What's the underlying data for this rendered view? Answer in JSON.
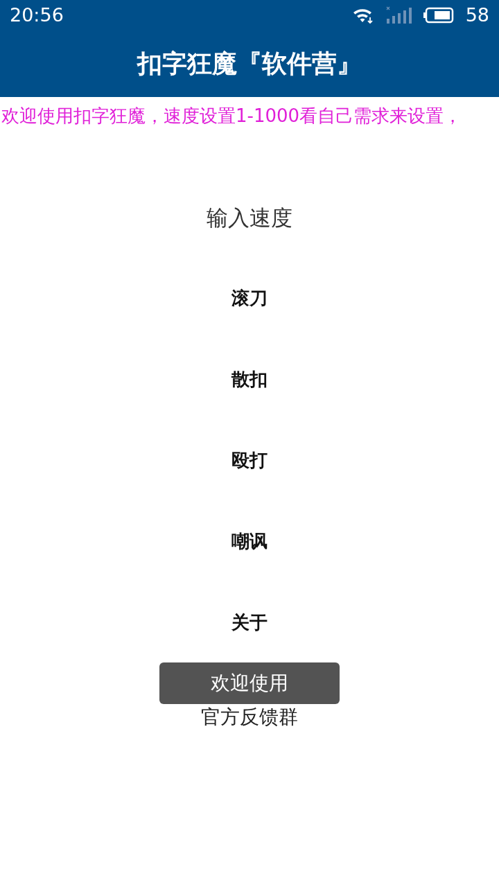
{
  "status_bar": {
    "time": "20:56",
    "battery": "58"
  },
  "app_bar": {
    "title": "扣字狂魔『软件营』"
  },
  "marquee": {
    "text": "欢迎使用扣字狂魔，速度设置1-1000看自己需求来设置，"
  },
  "speed_field": {
    "placeholder": "输入速度"
  },
  "buttons": [
    {
      "label": "滚刀"
    },
    {
      "label": "散扣"
    },
    {
      "label": "殴打"
    },
    {
      "label": "嘲讽"
    },
    {
      "label": "关于"
    }
  ],
  "feedback_link": {
    "label": "官方反馈群"
  },
  "toast": {
    "text": "欢迎使用"
  }
}
